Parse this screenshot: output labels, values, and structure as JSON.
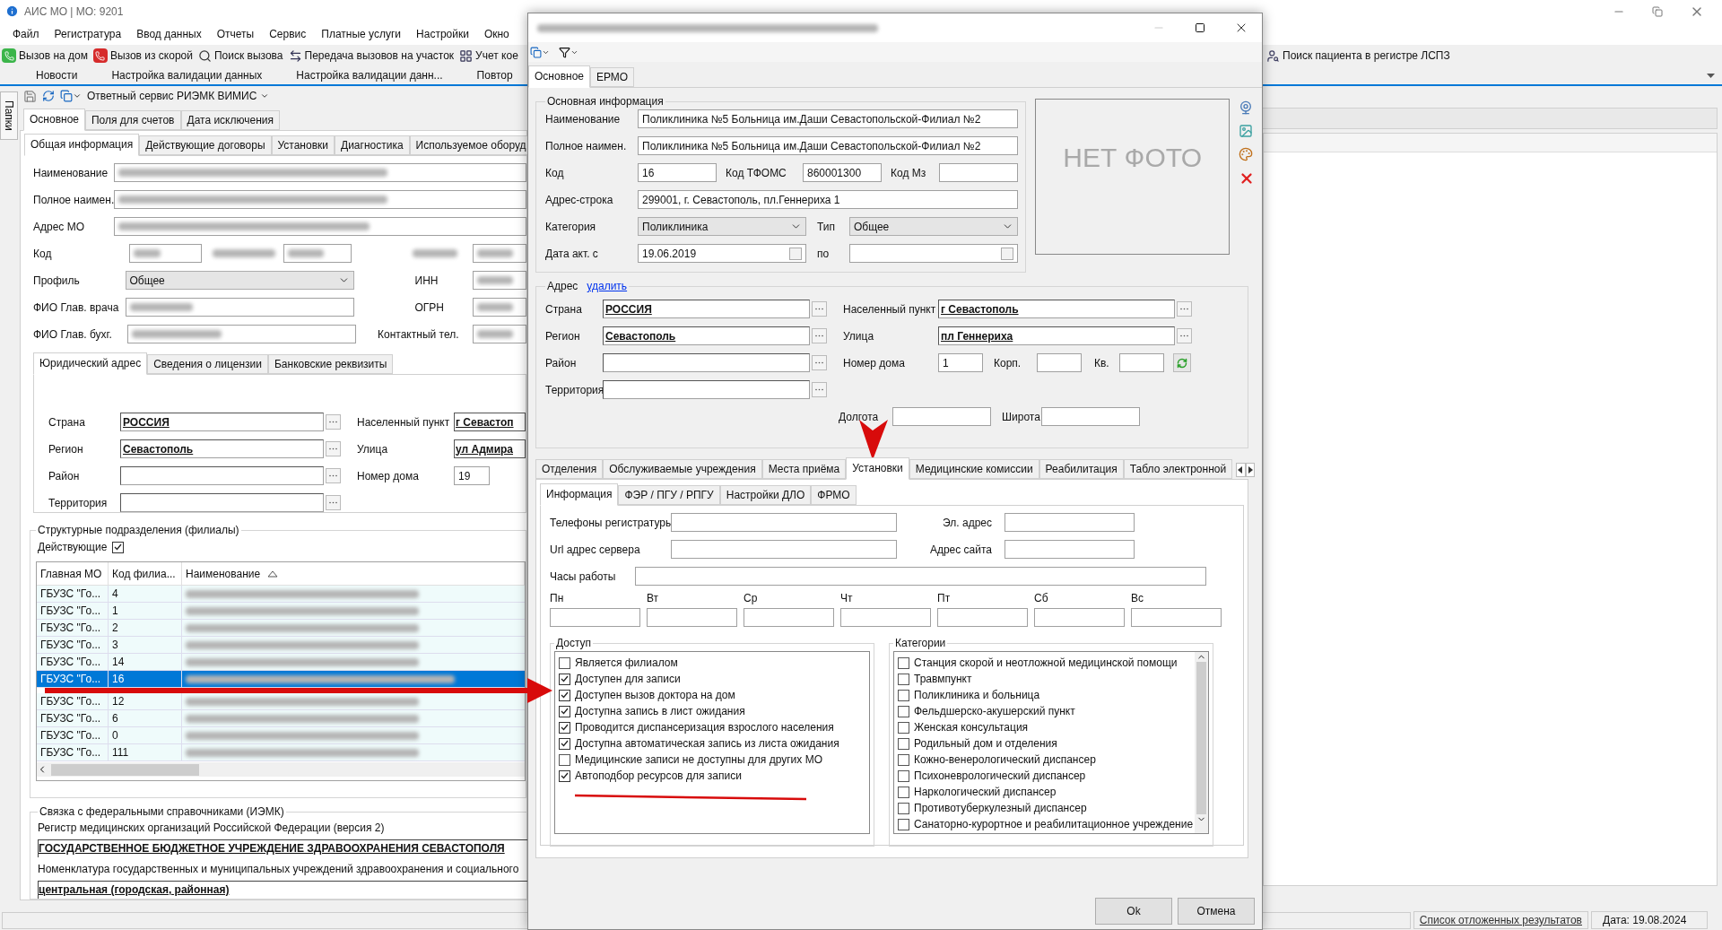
{
  "main_window": {
    "title": "АИС МО | МО: 9201",
    "menu": [
      "Файл",
      "Регистратура",
      "Ввод данных",
      "Отчеты",
      "Сервис",
      "Платные услуги",
      "Настройки",
      "Окно"
    ],
    "toolbar": [
      "Вызов на дом",
      "Вызов из скорой",
      "Поиск вызова",
      "Передача вызовов на участок",
      "Учет кое"
    ],
    "toolbar_right": [
      "Поиск пациента в регистре ЛСПЗ"
    ],
    "doc_tabs": [
      "Новости",
      "Настройка валидации данных",
      "Настройка валидации данн...",
      "Повтор"
    ],
    "side_tab": "Папки",
    "service_menu": "Ответный сервис РИЭМК ВИМИС",
    "tabs": [
      {
        "label": "Основное",
        "selected": true
      },
      {
        "label": "Поля для счетов",
        "selected": false
      },
      {
        "label": "Дата исключения",
        "selected": false
      }
    ],
    "subtabs": [
      {
        "label": "Общая информация",
        "selected": true
      },
      {
        "label": "Действующие договоры",
        "selected": false
      },
      {
        "label": "Установки",
        "selected": false
      },
      {
        "label": "Диагностика",
        "selected": false
      },
      {
        "label": "Используемое оборуд",
        "selected": false
      }
    ],
    "form": {
      "name_label": "Наименование",
      "full_name_label": "Полное наимен.",
      "address_label": "Адрес МО",
      "code_label": "Код",
      "profile_label": "Профиль",
      "profile": "Общее",
      "doctor_label": "ФИО Глав. врача",
      "accountant_label": "ФИО Глав. бухг.",
      "inn_label": "ИНН",
      "ogrn_label": "ОГРН",
      "phone_label": "Контактный тел."
    },
    "address_tabs": [
      {
        "label": "Юридический адрес",
        "selected": true
      },
      {
        "label": "Сведения о лицензии",
        "selected": false
      },
      {
        "label": "Банковские реквизиты",
        "selected": false
      }
    ],
    "address": {
      "country_label": "Страна",
      "country": "РОССИЯ",
      "region_label": "Регион",
      "region": "Севастополь",
      "district_label": "Район",
      "territory_label": "Территория",
      "locality_label": "Населенный пункт",
      "locality": "г Севастоп",
      "street_label": "Улица",
      "street": "ул Адмира",
      "house_label": "Номер дома",
      "house": "19"
    },
    "branches": {
      "title": "Структурные подразделения (филиалы)",
      "active_label": "Действующие",
      "active_checked": true,
      "columns": [
        {
          "label": "Главная МО",
          "sorted": false
        },
        {
          "label": "Код филиа...",
          "sorted": false
        },
        {
          "label": "Наименование",
          "sorted": true
        }
      ],
      "rows": [
        {
          "main": "ГБУЗС \"Го...",
          "code": "4",
          "selected": false
        },
        {
          "main": "ГБУЗС \"Го...",
          "code": "1",
          "selected": false
        },
        {
          "main": "ГБУЗС \"Го...",
          "code": "2",
          "selected": false
        },
        {
          "main": "ГБУЗС \"Го...",
          "code": "3",
          "selected": false
        },
        {
          "main": "ГБУЗС \"Го...",
          "code": "14",
          "selected": false
        },
        {
          "main": "ГБУЗС \"Го...",
          "code": "16",
          "selected": true
        },
        {
          "main": "ГБУЗС \"Го...",
          "code": "12",
          "selected": false
        },
        {
          "main": "ГБУЗС \"Го...",
          "code": "6",
          "selected": false
        },
        {
          "main": "ГБУЗС \"Го...",
          "code": "0",
          "selected": false
        },
        {
          "main": "ГБУЗС \"Го...",
          "code": "111",
          "selected": false
        }
      ]
    },
    "federal": {
      "title": "Связка с федеральными справочниками (ИЭМК)",
      "register_label": "Регистр медицинских организаций Российской Федерации (версия 2)",
      "register": "ГОСУДАРСТВЕННОЕ БЮДЖЕТНОЕ УЧРЕЖДЕНИЕ ЗДРАВООХРАНЕНИЯ СЕВАСТОПОЛЯ",
      "nomenclature_label": "Номенклатура государственных и муниципальных учреждений здравоохранения и социального",
      "nomenclature": "центральная (городская, районная)"
    },
    "status_bar": {
      "link": "Список отложенных результатов",
      "date": "Дата: 19.08.2024"
    }
  },
  "dialog": {
    "tabs": [
      {
        "label": "Основное",
        "selected": true
      },
      {
        "label": "ЕРМО",
        "selected": false
      }
    ],
    "main_group": {
      "title": "Основная информация",
      "name_label": "Наименование",
      "name": "Поликлиника №5 Больница им.Даши Севастопольской-Филиал №2",
      "full_name_label": "Полное наимен.",
      "full_name": "Поликлиника №5 Больница им.Даши Севастопольской-Филиал №2",
      "code_label": "Код",
      "code": "16",
      "tfoms_label": "Код ТФОМС",
      "tfoms": "860001300",
      "mz_label": "Код Мз",
      "address_label": "Адрес-строка",
      "address": "299001, г. Севастополь, пл.Геннериха 1",
      "category_label": "Категория",
      "category": "Поликлиника",
      "type_label": "Тип",
      "type": "Общее",
      "date_from_label": "Дата акт. с",
      "date_from": "19.06.2019",
      "date_to_label": "по"
    },
    "photo_placeholder": "НЕТ ФОТО",
    "address": {
      "title": "Адрес",
      "delete_link": "удалить",
      "country_label": "Страна",
      "country": "РОССИЯ",
      "region_label": "Регион",
      "region": "Севастополь",
      "district_label": "Район",
      "territory_label": "Территория",
      "locality_label": "Населенный пункт",
      "locality": "г Севастополь",
      "street_label": "Улица",
      "street": "пл Геннериха",
      "house_label": "Номер дома",
      "house": "1",
      "building_label": "Корп.",
      "flat_label": "Кв.",
      "longitude_label": "Долгота",
      "latitude_label": "Широта"
    },
    "section_tabs": [
      {
        "label": "Отделения",
        "selected": false
      },
      {
        "label": "Обслуживаемые учреждения",
        "selected": false
      },
      {
        "label": "Места приёма",
        "selected": false
      },
      {
        "label": "Установки",
        "selected": true
      },
      {
        "label": "Медицинские комиссии",
        "selected": false
      },
      {
        "label": "Реабилитация",
        "selected": false
      },
      {
        "label": "Табло электронной",
        "selected": false
      }
    ],
    "settings_tabs": [
      {
        "label": "Информация",
        "selected": true
      },
      {
        "label": "ФЭР / ПГУ / РПГУ",
        "selected": false
      },
      {
        "label": "Настройки ДЛО",
        "selected": false
      },
      {
        "label": "ФРМО",
        "selected": false
      }
    ],
    "info": {
      "phones_label": "Телефоны регистратуры",
      "email_label": "Эл. адрес",
      "url_label": "Url адрес сервера",
      "site_label": "Адрес сайта",
      "hours_label": "Часы работы",
      "days": [
        "Пн",
        "Вт",
        "Ср",
        "Чт",
        "Пт",
        "Сб",
        "Вс"
      ]
    },
    "access": {
      "title": "Доступ",
      "items": [
        {
          "label": "Является филиалом",
          "checked": false
        },
        {
          "label": "Доступен для записи",
          "checked": true
        },
        {
          "label": "Доступен вызов доктора на дом",
          "checked": true
        },
        {
          "label": "Доступна запись в лист ожидания",
          "checked": true
        },
        {
          "label": "Проводится диспансеризация взрослого населения",
          "checked": true
        },
        {
          "label": "Доступна автоматическая запись из листа ожидания",
          "checked": true
        },
        {
          "label": "Медицинские записи не доступны для других МО",
          "checked": false
        },
        {
          "label": "Автоподбор ресурсов для записи",
          "checked": true
        }
      ]
    },
    "categories": {
      "title": "Категории",
      "items": [
        {
          "label": "Станция скорой и неотложной медицинской помощи",
          "checked": false
        },
        {
          "label": "Травмпункт",
          "checked": false
        },
        {
          "label": "Поликлиника и больница",
          "checked": false
        },
        {
          "label": "Фельдшерско-акушерский пункт",
          "checked": false
        },
        {
          "label": "Женская консультация",
          "checked": false
        },
        {
          "label": "Родильный дом и отделения",
          "checked": false
        },
        {
          "label": "Кожно-венерологический диспансер",
          "checked": false
        },
        {
          "label": "Психоневрологический диспансер",
          "checked": false
        },
        {
          "label": "Наркологический диспансер",
          "checked": false
        },
        {
          "label": "Противотуберкулезный диспансер",
          "checked": false
        },
        {
          "label": "Санаторно-курортное и реабилитационное учреждение",
          "checked": false
        }
      ]
    },
    "buttons": [
      "Ok",
      "Отмена"
    ]
  }
}
